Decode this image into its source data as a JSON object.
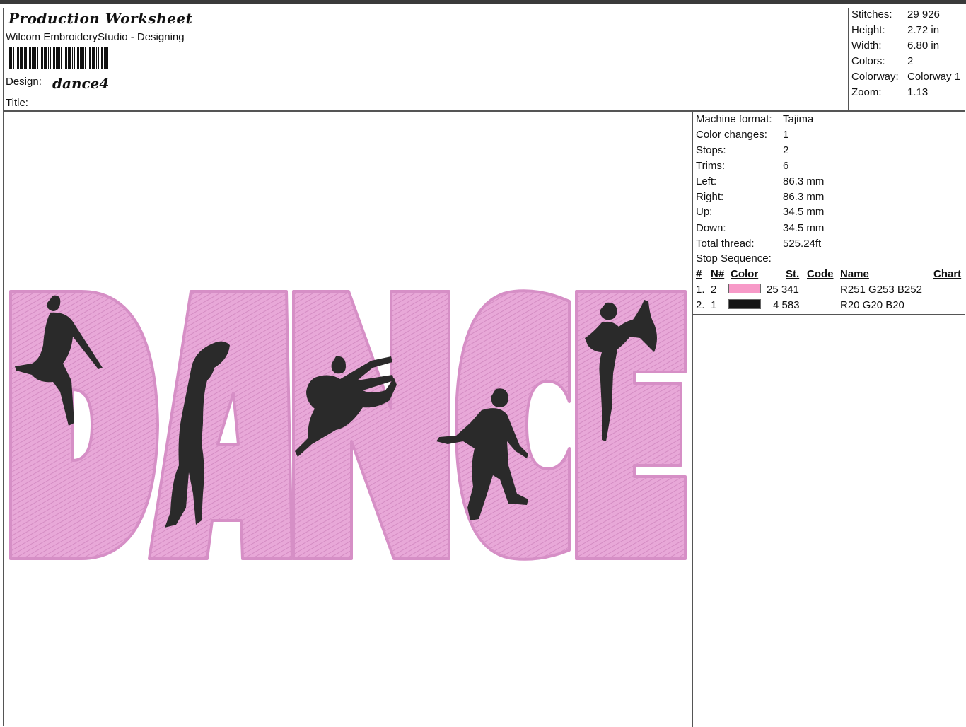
{
  "header": {
    "title": "Production Worksheet",
    "subtitle": "Wilcom EmbroideryStudio - Designing",
    "design_label": "Design:",
    "design_name": "dance4",
    "title_label": "Title:"
  },
  "summary": [
    {
      "label": "Stitches:",
      "value": "29 926"
    },
    {
      "label": "Height:",
      "value": "2.72 in"
    },
    {
      "label": "Width:",
      "value": "6.80 in"
    },
    {
      "label": "Colors:",
      "value": "2"
    },
    {
      "label": "Colorway:",
      "value": "Colorway 1"
    },
    {
      "label": "Zoom:",
      "value": "1.13"
    }
  ],
  "machine_info": [
    {
      "label": "Machine format:",
      "value": "Tajima"
    },
    {
      "label": "Color changes:",
      "value": "1"
    },
    {
      "label": "Stops:",
      "value": "2"
    },
    {
      "label": "Trims:",
      "value": "6"
    },
    {
      "label": "Left:",
      "value": "86.3 mm"
    },
    {
      "label": "Right:",
      "value": "86.3 mm"
    },
    {
      "label": "Up:",
      "value": "34.5 mm"
    },
    {
      "label": "Down:",
      "value": "34.5 mm"
    },
    {
      "label": "Total thread:",
      "value": "525.24ft"
    }
  ],
  "stop_sequence": {
    "title": "Stop Sequence:",
    "headers": {
      "num": "#",
      "needle": "N#",
      "color": "Color",
      "stitches": "St.",
      "code": "Code",
      "name": "Name",
      "chart": "Chart"
    },
    "rows": [
      {
        "num": "1.",
        "needle": "2",
        "color": "#f79ac8",
        "stitches": "25 341",
        "code": "",
        "name": "R251 G253 B252",
        "chart": ""
      },
      {
        "num": "2.",
        "needle": "1",
        "color": "#141414",
        "stitches": "4 583",
        "code": "",
        "name": "R20 G20 B20",
        "chart": ""
      }
    ]
  },
  "preview": {
    "design_letters": [
      "D",
      "A",
      "N",
      "C",
      "E"
    ],
    "fill_color": "#e6a3d6",
    "outline_color": "#d992c8",
    "silhouette_color": "#262626"
  }
}
